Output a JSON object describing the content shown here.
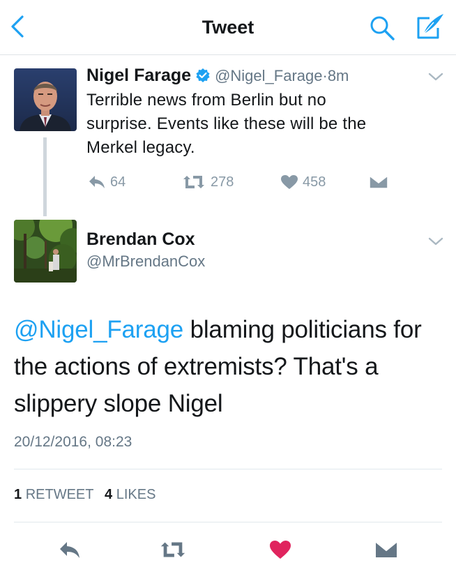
{
  "header": {
    "title": "Tweet"
  },
  "parent_tweet": {
    "author_name": "Nigel Farage",
    "handle": "@Nigel_Farage",
    "time": "8m",
    "text_lines": [
      "Terrible news from Berlin but no",
      "surprise. Events like these will be the",
      "Merkel legacy."
    ],
    "reply_count": "64",
    "retweet_count": "278",
    "like_count": "458"
  },
  "reply_tweet": {
    "author_name": "Brendan Cox",
    "handle": "@MrBrendanCox",
    "mention": "@Nigel_Farage",
    "text_line1_rest": " blaming politicians for",
    "text_line2": "the actions of extremists? That's a",
    "text_line3": "slippery slope Nigel",
    "timestamp": "20/12/2016, 08:23",
    "retweets_count": "1",
    "retweets_label": "RETWEET",
    "likes_count": "4",
    "likes_label": "LIKES"
  },
  "colors": {
    "accent": "#1da1f2",
    "like": "#e0245e",
    "muted": "#657786",
    "icon_gray": "#8899a6",
    "verified": "#1da1f2"
  },
  "icons": [
    "back-icon",
    "search-icon",
    "compose-icon",
    "verified-badge-icon",
    "chevron-down-icon",
    "reply-icon",
    "retweet-icon",
    "heart-icon",
    "direct-message-icon"
  ]
}
